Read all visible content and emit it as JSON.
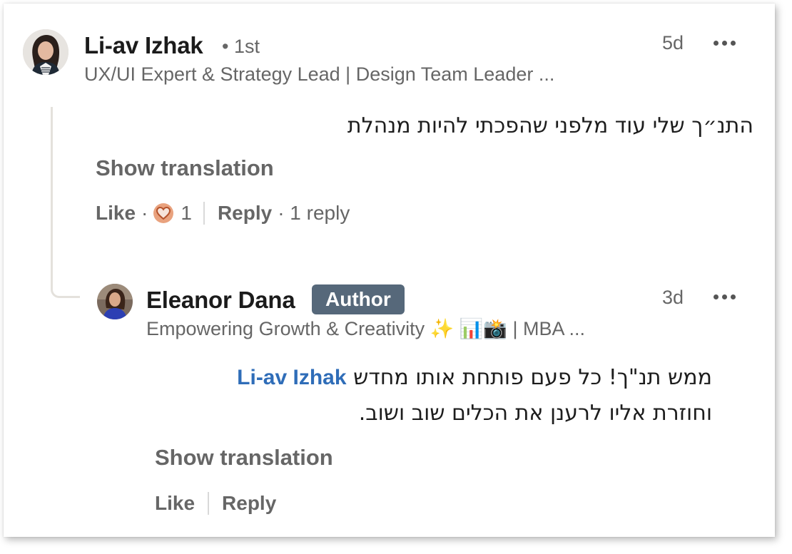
{
  "comment": {
    "author_name": "Li-av Izhak",
    "degree": "• 1st",
    "headline": "UX/UI Expert & Strategy Lead | Design Team Leader ...",
    "time": "5d",
    "more_icon": "ellipsis-icon",
    "text": "התנ״ך שלי עוד מלפני שהפכתי להיות מנהלת",
    "show_translation": "Show translation",
    "like_label": "Like",
    "reaction_icon": "love-reaction-icon",
    "reaction_count": "1",
    "reply_label": "Reply",
    "reply_count": "· 1 reply"
  },
  "reply": {
    "author_name": "Eleanor Dana",
    "badge": "Author",
    "headline": "Empowering Growth & Creativity ✨ 📊📸 | MBA ...",
    "time": "3d",
    "more_icon": "ellipsis-icon",
    "mention": "Li-av Izhak",
    "text_line1_rest": "ממש תנ\"ך! כל פעם פותחת אותו מחדש",
    "text_line2": "וחוזרת אליו לרענן את הכלים שוב ושוב.",
    "show_translation": "Show translation",
    "like_label": "Like",
    "reply_label": "Reply"
  },
  "colors": {
    "mention": "#2f6db8",
    "badge_bg": "#56687a",
    "secondary_text": "#666666",
    "reaction": "#e9a27e"
  }
}
